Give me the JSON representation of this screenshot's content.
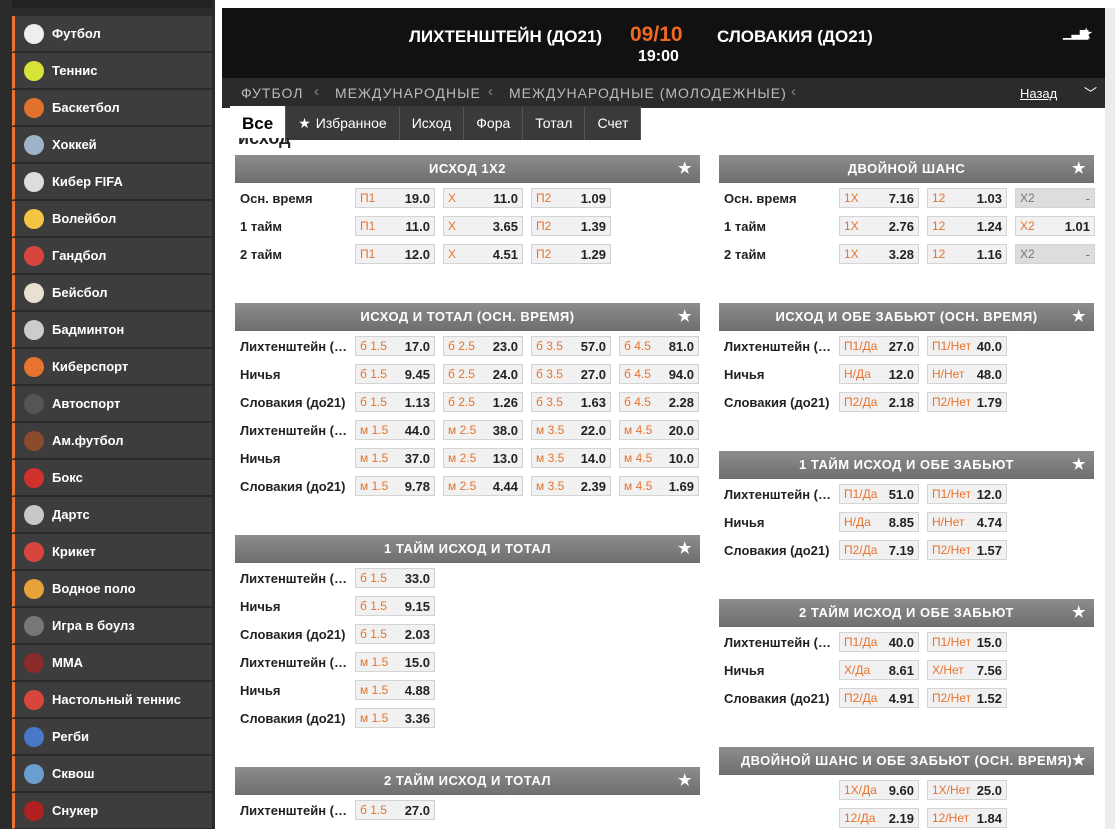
{
  "sidebar": [
    {
      "label": "Футбол",
      "icon": "soccer-ball-icon",
      "color": "#eeeeee"
    },
    {
      "label": "Теннис",
      "icon": "tennis-ball-icon",
      "color": "#d8e33a"
    },
    {
      "label": "Баскетбол",
      "icon": "basketball-icon",
      "color": "#e0722b"
    },
    {
      "label": "Хоккей",
      "icon": "hockey-stick-icon",
      "color": "#9fb3c8"
    },
    {
      "label": "Кибер FIFA",
      "icon": "cyber-fifa-icon",
      "color": "#dddddd"
    },
    {
      "label": "Волейбол",
      "icon": "volleyball-icon",
      "color": "#f4c542"
    },
    {
      "label": "Гандбол",
      "icon": "handball-icon",
      "color": "#d9453c"
    },
    {
      "label": "Бейсбол",
      "icon": "baseball-icon",
      "color": "#e8e0d0"
    },
    {
      "label": "Бадминтон",
      "icon": "shuttlecock-icon",
      "color": "#cccccc"
    },
    {
      "label": "Киберспорт",
      "icon": "esports-icon",
      "color": "#e8732e"
    },
    {
      "label": "Автоспорт",
      "icon": "tire-icon",
      "color": "#555555"
    },
    {
      "label": "Ам.футбол",
      "icon": "american-football-icon",
      "color": "#8b4a2b"
    },
    {
      "label": "Бокс",
      "icon": "boxing-glove-icon",
      "color": "#d0312d"
    },
    {
      "label": "Дартс",
      "icon": "darts-icon",
      "color": "#c8c8c8"
    },
    {
      "label": "Крикет",
      "icon": "cricket-ball-icon",
      "color": "#d9453c"
    },
    {
      "label": "Водное поло",
      "icon": "water-polo-ball-icon",
      "color": "#e8a23a"
    },
    {
      "label": "Игра в боулз",
      "icon": "bowls-icon",
      "color": "#777777"
    },
    {
      "label": "MMA",
      "icon": "mma-icon",
      "color": "#8b2a2a"
    },
    {
      "label": "Настольный теннис",
      "icon": "table-tennis-icon",
      "color": "#d9453c"
    },
    {
      "label": "Регби",
      "icon": "rugby-ball-icon",
      "color": "#4a78c8"
    },
    {
      "label": "Сквош",
      "icon": "squash-racket-icon",
      "color": "#6aa0d0"
    },
    {
      "label": "Снукер",
      "icon": "snooker-ball-icon",
      "color": "#b02020"
    }
  ],
  "header": {
    "team1": "ЛИХТЕНШТЕЙН (ДО21)",
    "team2": "СЛОВАКИЯ (ДО21)",
    "date": "09/10",
    "time": "19:00",
    "stats_icon": "stats-icon",
    "star_icon": "star-icon"
  },
  "breadcrumbs": {
    "items": [
      "ФУТБОЛ",
      "МЕЖДУНАРОДНЫЕ",
      "МЕЖДУНАРОДНЫЕ (МОЛОДЕЖНЫЕ)"
    ],
    "back": "Назад",
    "chevron_icon": "chevron-down-icon"
  },
  "tabs": [
    {
      "label": "Все",
      "active": true
    },
    {
      "label": "Избранное",
      "icon": "★"
    },
    {
      "label": "Исход"
    },
    {
      "label": "Фора"
    },
    {
      "label": "Тотал"
    },
    {
      "label": "Счет"
    }
  ],
  "section_title": "исход",
  "colors": {
    "accent": "#e8732e",
    "header_bg": "#111111",
    "market_head": "#7a7a7a"
  },
  "markets": [
    {
      "title": "ИСХОД 1X2",
      "col": 0,
      "rows": [
        {
          "label": "Осн. время",
          "odds": [
            [
              "П1",
              "19.0"
            ],
            [
              "X",
              "11.0"
            ],
            [
              "П2",
              "1.09"
            ]
          ]
        },
        {
          "label": "1 тайм",
          "odds": [
            [
              "П1",
              "11.0"
            ],
            [
              "X",
              "3.65"
            ],
            [
              "П2",
              "1.39"
            ]
          ]
        },
        {
          "label": "2 тайм",
          "odds": [
            [
              "П1",
              "12.0"
            ],
            [
              "X",
              "4.51"
            ],
            [
              "П2",
              "1.29"
            ]
          ]
        }
      ]
    },
    {
      "title": "ИСХОД И ТОТАЛ (ОСН. ВРЕМЯ)",
      "col": 0,
      "rows": [
        {
          "label": "Лихтенштейн (до21)",
          "odds": [
            [
              "б 1.5",
              "17.0"
            ],
            [
              "б 2.5",
              "23.0"
            ],
            [
              "б 3.5",
              "57.0"
            ],
            [
              "б 4.5",
              "81.0"
            ]
          ]
        },
        {
          "label": "Ничья",
          "odds": [
            [
              "б 1.5",
              "9.45"
            ],
            [
              "б 2.5",
              "24.0"
            ],
            [
              "б 3.5",
              "27.0"
            ],
            [
              "б 4.5",
              "94.0"
            ]
          ]
        },
        {
          "label": "Словакия (до21)",
          "odds": [
            [
              "б 1.5",
              "1.13"
            ],
            [
              "б 2.5",
              "1.26"
            ],
            [
              "б 3.5",
              "1.63"
            ],
            [
              "б 4.5",
              "2.28"
            ]
          ]
        },
        {
          "label": "Лихтенштейн (до21)",
          "odds": [
            [
              "м 1.5",
              "44.0"
            ],
            [
              "м 2.5",
              "38.0"
            ],
            [
              "м 3.5",
              "22.0"
            ],
            [
              "м 4.5",
              "20.0"
            ]
          ]
        },
        {
          "label": "Ничья",
          "odds": [
            [
              "м 1.5",
              "37.0"
            ],
            [
              "м 2.5",
              "13.0"
            ],
            [
              "м 3.5",
              "14.0"
            ],
            [
              "м 4.5",
              "10.0"
            ]
          ]
        },
        {
          "label": "Словакия (до21)",
          "odds": [
            [
              "м 1.5",
              "9.78"
            ],
            [
              "м 2.5",
              "4.44"
            ],
            [
              "м 3.5",
              "2.39"
            ],
            [
              "м 4.5",
              "1.69"
            ]
          ]
        }
      ]
    },
    {
      "title": "1 ТАЙМ ИСХОД И ТОТАЛ",
      "col": 0,
      "rows": [
        {
          "label": "Лихтенштейн (до21)",
          "odds": [
            [
              "б 1.5",
              "33.0"
            ]
          ]
        },
        {
          "label": "Ничья",
          "odds": [
            [
              "б 1.5",
              "9.15"
            ]
          ]
        },
        {
          "label": "Словакия (до21)",
          "odds": [
            [
              "б 1.5",
              "2.03"
            ]
          ]
        },
        {
          "label": "Лихтенштейн (до21)",
          "odds": [
            [
              "м 1.5",
              "15.0"
            ]
          ]
        },
        {
          "label": "Ничья",
          "odds": [
            [
              "м 1.5",
              "4.88"
            ]
          ]
        },
        {
          "label": "Словакия (до21)",
          "odds": [
            [
              "м 1.5",
              "3.36"
            ]
          ]
        }
      ]
    },
    {
      "title": "2 ТАЙМ ИСХОД И ТОТАЛ",
      "col": 0,
      "rows": [
        {
          "label": "Лихтенштейн (до21)",
          "odds": [
            [
              "б 1.5",
              "27.0"
            ]
          ]
        }
      ]
    },
    {
      "title": "ДВОЙНОЙ ШАНС",
      "col": 1,
      "rows": [
        {
          "label": "Осн. время",
          "odds": [
            [
              "1X",
              "7.16"
            ],
            [
              "12",
              "1.03"
            ],
            [
              "X2",
              "-",
              "dis"
            ]
          ]
        },
        {
          "label": "1 тайм",
          "odds": [
            [
              "1X",
              "2.76"
            ],
            [
              "12",
              "1.24"
            ],
            [
              "X2",
              "1.01"
            ]
          ]
        },
        {
          "label": "2 тайм",
          "odds": [
            [
              "1X",
              "3.28"
            ],
            [
              "12",
              "1.16"
            ],
            [
              "X2",
              "-",
              "dis"
            ]
          ]
        }
      ]
    },
    {
      "title": "ИСХОД И ОБЕ ЗАБЬЮТ (ОСН. ВРЕМЯ)",
      "col": 1,
      "rows": [
        {
          "label": "Лихтенштейн (до21)",
          "odds": [
            [
              "П1/Да",
              "27.0"
            ],
            [
              "П1/Нет",
              "40.0"
            ]
          ]
        },
        {
          "label": "Ничья",
          "odds": [
            [
              "Н/Да",
              "12.0"
            ],
            [
              "Н/Нет",
              "48.0"
            ]
          ]
        },
        {
          "label": "Словакия (до21)",
          "odds": [
            [
              "П2/Да",
              "2.18"
            ],
            [
              "П2/Нет",
              "1.79"
            ]
          ]
        }
      ]
    },
    {
      "title": "1 ТАЙМ ИСХОД И ОБЕ ЗАБЬЮТ",
      "col": 1,
      "rows": [
        {
          "label": "Лихтенштейн (до21)",
          "odds": [
            [
              "П1/Да",
              "51.0"
            ],
            [
              "П1/Нет",
              "12.0"
            ]
          ]
        },
        {
          "label": "Ничья",
          "odds": [
            [
              "Н/Да",
              "8.85"
            ],
            [
              "Н/Нет",
              "4.74"
            ]
          ]
        },
        {
          "label": "Словакия (до21)",
          "odds": [
            [
              "П2/Да",
              "7.19"
            ],
            [
              "П2/Нет",
              "1.57"
            ]
          ]
        }
      ]
    },
    {
      "title": "2 ТАЙМ ИСХОД И ОБЕ ЗАБЬЮТ",
      "col": 1,
      "rows": [
        {
          "label": "Лихтенштейн (до21)",
          "odds": [
            [
              "П1/Да",
              "40.0"
            ],
            [
              "П1/Нет",
              "15.0"
            ]
          ]
        },
        {
          "label": "Ничья",
          "odds": [
            [
              "Х/Да",
              "8.61"
            ],
            [
              "Х/Нет",
              "7.56"
            ]
          ]
        },
        {
          "label": "Словакия (до21)",
          "odds": [
            [
              "П2/Да",
              "4.91"
            ],
            [
              "П2/Нет",
              "1.52"
            ]
          ]
        }
      ]
    },
    {
      "title": "ДВОЙНОЙ ШАНС И ОБЕ ЗАБЬЮТ (ОСН. ВРЕМЯ)",
      "col": 1,
      "rows": [
        {
          "label": "",
          "odds": [
            [
              "1X/Да",
              "9.60"
            ],
            [
              "1X/Нет",
              "25.0"
            ]
          ]
        },
        {
          "label": "",
          "odds": [
            [
              "12/Да",
              "2.19"
            ],
            [
              "12/Нет",
              "1.84"
            ]
          ]
        }
      ]
    }
  ]
}
